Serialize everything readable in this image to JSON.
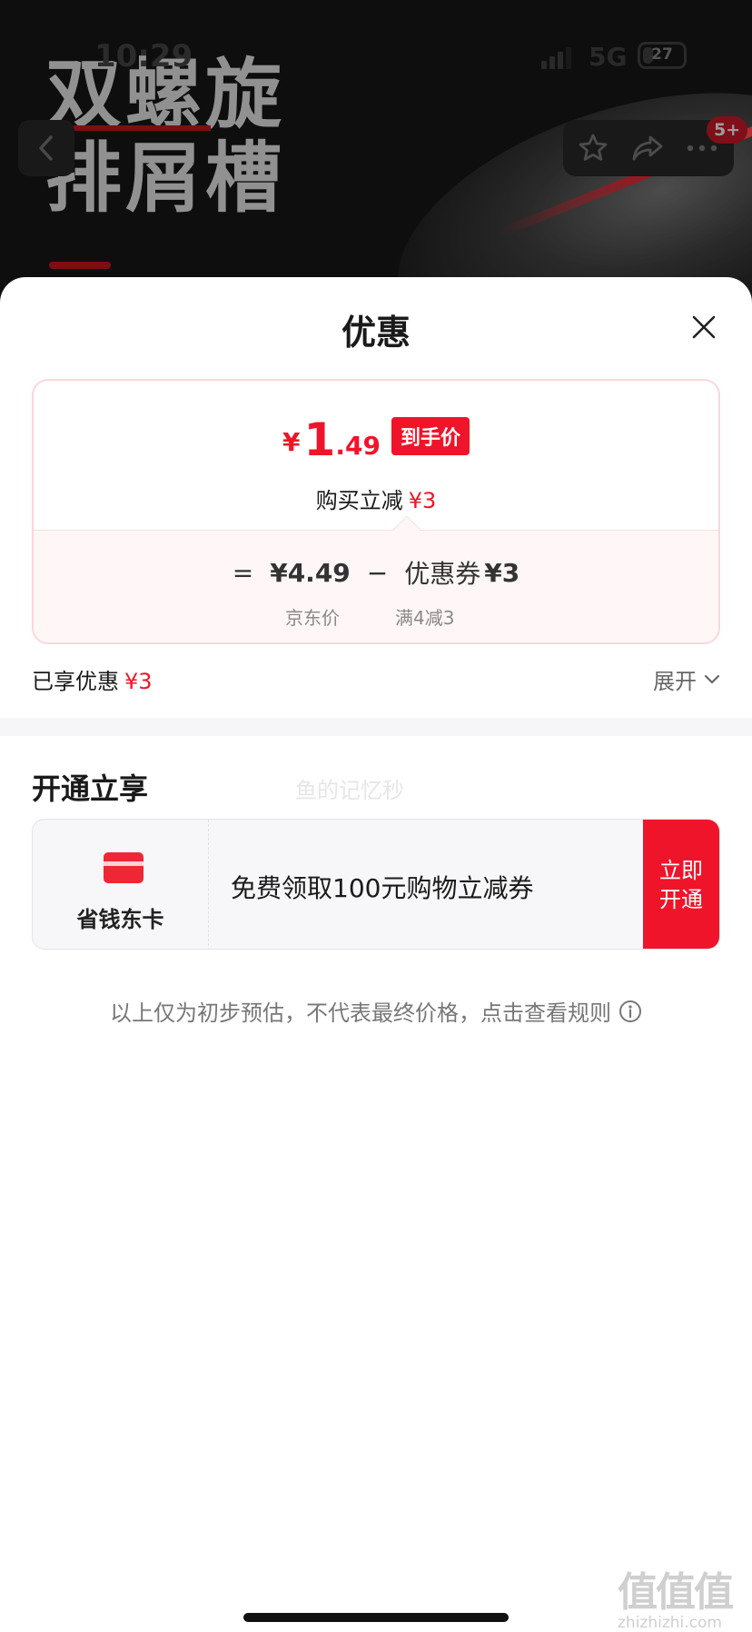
{
  "status_bar": {
    "time": "10:29",
    "network": "5G",
    "battery": "27",
    "battery_level": 0.27
  },
  "background": {
    "title_lines": [
      "双螺旋",
      "排屑槽"
    ],
    "nav_badge": "5+",
    "icons": {
      "back": "chevron-left-icon",
      "favorite": "star-icon",
      "share": "share-icon",
      "more": "more-icon"
    }
  },
  "sheet": {
    "title": "优惠",
    "close_icon": "close-icon",
    "price_card": {
      "currency": "¥",
      "price_int": "1",
      "price_dec": ".49",
      "tag": "到手价",
      "sub_label": "购买立减",
      "sub_amount": "¥3",
      "eq": "=",
      "jd_price": "¥4.49",
      "minus": "−",
      "coupon_label": "优惠券",
      "coupon_value": "¥3",
      "jd_price_caption": "京东价",
      "coupon_caption": "满4减3"
    },
    "enjoyed": {
      "label": "已享优惠",
      "amount": "¥3",
      "expand_label": "展开"
    },
    "open_section": {
      "title": "开通立享",
      "watermark": "鱼的记忆秒",
      "card": {
        "name": "省钱东卡",
        "description": "免费领取100元购物立减券",
        "button_label": "立即开通"
      }
    },
    "disclaimer": "以上仅为初步预估，不代表最终价格，点击查看规则"
  },
  "site_watermark": {
    "logo": "值值值",
    "url": "zhizhizhi.com"
  },
  "colors": {
    "accent": "#f0142a",
    "text": "#1a1a1a",
    "muted": "#777777",
    "divider": "#f6f6f8"
  }
}
